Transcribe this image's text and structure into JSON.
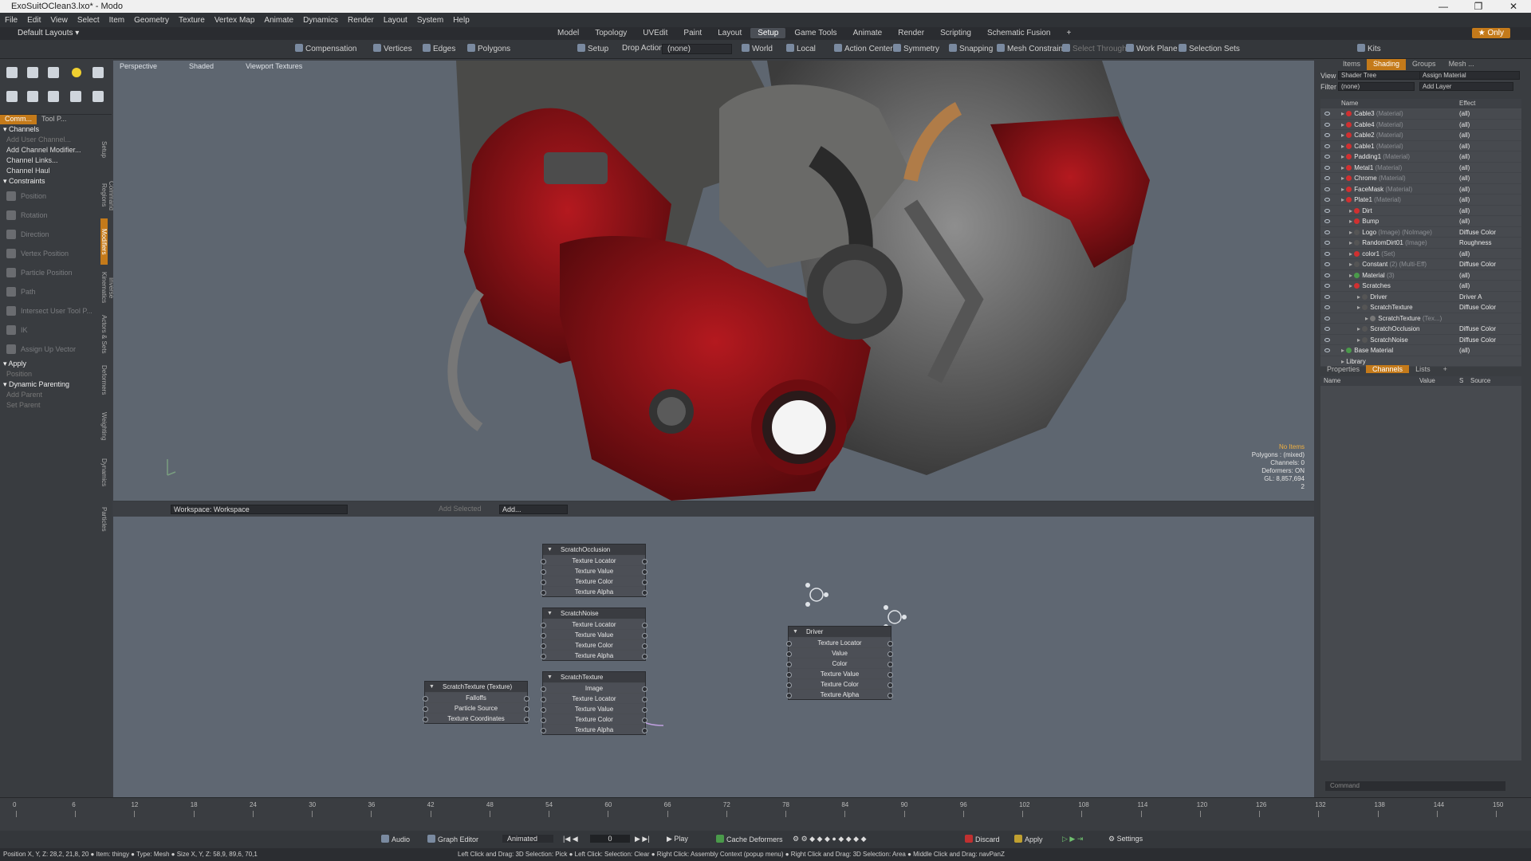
{
  "window": {
    "title": "ExoSuitOClean3.lxo* - Modo",
    "controls": [
      "—",
      "❐",
      "✕"
    ]
  },
  "menu": [
    "File",
    "Edit",
    "View",
    "Select",
    "Item",
    "Geometry",
    "Texture",
    "Vertex Map",
    "Animate",
    "Dynamics",
    "Render",
    "Layout",
    "System",
    "Help"
  ],
  "layout_selector": "Default Layouts",
  "tabs": [
    "Model",
    "Topology",
    "UVEdit",
    "Paint",
    "Layout",
    "Setup",
    "Game Tools",
    "Animate",
    "Render",
    "Scripting",
    "Schematic Fusion",
    "+"
  ],
  "active_tab": "Setup",
  "only_button": "Only",
  "toolbar": {
    "compensation": "Compensation",
    "vertices": "Vertices",
    "edges": "Edges",
    "polygons": "Polygons",
    "setup": "Setup",
    "drop_action_label": "Drop Action",
    "drop_action_value": "(none)",
    "world": "World",
    "local": "Local",
    "action_center": "Action Center",
    "symmetry": "Symmetry",
    "snapping": "Snapping",
    "mesh_constraint": "Mesh Constraint",
    "select_through": "Select Through",
    "work_plane": "Work Plane",
    "selection_sets": "Selection Sets",
    "kits": "Kits"
  },
  "left_panel": {
    "tabs": [
      "Comm...",
      "Tool P..."
    ],
    "vertical_tabs": [
      "Setup",
      "Command Regions",
      "Modifiers",
      "Inverse Kinematics",
      "Actors & Sets",
      "Deformers",
      "Weighting",
      "Dynamics",
      "Particles"
    ],
    "channels_header": "Channels",
    "channel_items": [
      {
        "label": "Add User Channel...",
        "dim": true
      },
      {
        "label": "Add Channel Modifier...",
        "dim": false
      },
      {
        "label": "Channel Links...",
        "dim": false
      },
      {
        "label": "Channel Haul",
        "dim": false
      }
    ],
    "constraints_header": "Constraints",
    "constraint_items": [
      "Position",
      "Rotation",
      "Direction",
      "Vertex Position",
      "Particle Position",
      "Path",
      "Intersect User Tool P...",
      "IK",
      "Assign Up Vector"
    ],
    "apply_header": "Apply",
    "apply_items": [
      "Position"
    ],
    "dynamic_parenting_header": "Dynamic Parenting",
    "dynamic_items": [
      "Add Parent"
    ],
    "set_parent_label": "Set Parent"
  },
  "viewport": {
    "labels": [
      "Perspective",
      "Shaded",
      "Viewport Textures"
    ],
    "info": [
      "No Items",
      "Polygons : (mixed)",
      "Channels: 0",
      "Deformers: ON",
      "GL: 8,857,694",
      "2"
    ]
  },
  "schematic": {
    "workspace": "Workspace: Workspace",
    "add_selected": "Add Selected",
    "add": "Add...",
    "nodes": [
      {
        "title": "ScratchOcclusion",
        "rows": [
          "Texture Locator",
          "Texture Value",
          "Texture Color",
          "Texture Alpha"
        ]
      },
      {
        "title": "ScratchNoise",
        "rows": [
          "Texture Locator",
          "Texture Value",
          "Texture Color",
          "Texture Alpha"
        ]
      },
      {
        "title": "ScratchTexture",
        "rows": [
          "Image",
          "Texture Locator",
          "Texture Value",
          "Texture Color",
          "Texture Alpha"
        ]
      },
      {
        "title": "ScratchTexture (Texture)",
        "rows": [
          "Falloffs",
          "Particle Source",
          "Texture Coordinates"
        ]
      },
      {
        "title": "Driver",
        "rows": [
          "Texture Locator",
          "Value",
          "Color",
          "Texture Value",
          "Texture Color",
          "Texture Alpha"
        ]
      }
    ]
  },
  "right_panel": {
    "tabs": [
      "Items",
      "Shading",
      "Groups",
      "Mesh ..."
    ],
    "active_tab": "Shading",
    "view_label": "View",
    "view_value": "Shader Tree",
    "assign_material": "Assign Material",
    "filter_label": "Filter",
    "filter_value": "(none)",
    "add_layer": "Add Layer",
    "col_name": "Name",
    "col_effect": "Effect",
    "rows": [
      {
        "indent": 0,
        "name": "Cable3",
        "sub": "(Material)",
        "effect": "(all)",
        "color": "#d03030"
      },
      {
        "indent": 0,
        "name": "Cable4",
        "sub": "(Material)",
        "effect": "(all)",
        "color": "#d03030"
      },
      {
        "indent": 0,
        "name": "Cable2",
        "sub": "(Material)",
        "effect": "(all)",
        "color": "#d03030"
      },
      {
        "indent": 0,
        "name": "Cable1",
        "sub": "(Material)",
        "effect": "(all)",
        "color": "#d03030"
      },
      {
        "indent": 0,
        "name": "Padding1",
        "sub": "(Material)",
        "effect": "(all)",
        "color": "#d03030"
      },
      {
        "indent": 0,
        "name": "Metal1",
        "sub": "(Material)",
        "effect": "(all)",
        "color": "#d03030"
      },
      {
        "indent": 0,
        "name": "Chrome",
        "sub": "(Material)",
        "effect": "(all)",
        "color": "#d03030"
      },
      {
        "indent": 0,
        "name": "FaceMask",
        "sub": "(Material)",
        "effect": "(all)",
        "color": "#d03030"
      },
      {
        "indent": 0,
        "name": "Plate1",
        "sub": "(Material)",
        "effect": "(all)",
        "color": "#d03030"
      },
      {
        "indent": 1,
        "name": "Dirt",
        "sub": "",
        "effect": "(all)",
        "color": "#d03030"
      },
      {
        "indent": 1,
        "name": "Bump",
        "sub": "",
        "effect": "(all)",
        "color": "#d03030"
      },
      {
        "indent": 1,
        "name": "Logo",
        "sub": "(Image) (NoImage)",
        "effect": "Diffuse Color",
        "color": "#555"
      },
      {
        "indent": 1,
        "name": "RandomDirt01",
        "sub": "(Image)",
        "effect": "Roughness",
        "color": "#555"
      },
      {
        "indent": 1,
        "name": "color1",
        "sub": "(Set)",
        "effect": "(all)",
        "color": "#d03030"
      },
      {
        "indent": 1,
        "name": "Constant",
        "sub": "(2) (Multi-Eff)",
        "effect": "Diffuse Color",
        "color": "#555"
      },
      {
        "indent": 1,
        "name": "Material",
        "sub": "(3)",
        "effect": "(all)",
        "color": "#4a9a4a"
      },
      {
        "indent": 1,
        "name": "Scratches",
        "sub": "",
        "effect": "(all)",
        "color": "#d03030"
      },
      {
        "indent": 2,
        "name": "Driver",
        "sub": "",
        "effect": "Driver A",
        "color": "#555"
      },
      {
        "indent": 2,
        "name": "ScratchTexture",
        "sub": "",
        "effect": "Diffuse Color",
        "color": "#555"
      },
      {
        "indent": 3,
        "name": "ScratchTexture",
        "sub": "(Tex...)",
        "effect": "",
        "color": "#777"
      },
      {
        "indent": 2,
        "name": "ScratchOcclusion",
        "sub": "",
        "effect": "Diffuse Color",
        "color": "#555"
      },
      {
        "indent": 2,
        "name": "ScratchNoise",
        "sub": "",
        "effect": "Diffuse Color",
        "color": "#555"
      },
      {
        "indent": 0,
        "name": "Base Material",
        "sub": "",
        "effect": "(all)",
        "color": "#4a9a4a"
      },
      {
        "indent": 0,
        "name": "Library",
        "sub": "",
        "effect": "",
        "color": ""
      }
    ],
    "lower_tabs": [
      "Properties",
      "Channels",
      "Lists",
      "+"
    ],
    "lower_active": "Channels",
    "channel_cols": [
      "Name",
      "Value",
      "S",
      "Source"
    ],
    "command_placeholder": "Command"
  },
  "timeline": {
    "ticks": [
      "0",
      "6",
      "12",
      "18",
      "24",
      "30",
      "36",
      "42",
      "48",
      "54",
      "60",
      "66",
      "72",
      "78",
      "84",
      "90",
      "96",
      "102",
      "108",
      "114",
      "120",
      "126",
      "132",
      "138",
      "144",
      "150"
    ],
    "right_ticks": [
      "120",
      "150"
    ]
  },
  "transport": {
    "audio": "Audio",
    "graph_editor": "Graph Editor",
    "animated": "Animated",
    "frame": "0",
    "play": "Play",
    "cache_deformers": "Cache Deformers",
    "discard": "Discard",
    "apply": "Apply",
    "settings": "Settings"
  },
  "status": {
    "left": "Position X, Y, Z: 28,2, 21,8, 20 ● Item: thingy ● Type: Mesh ● Size X, Y, Z: 58,9, 89,6, 70,1",
    "hints": "Left Click and Drag: 3D Selection: Pick ● Left Click: Selection: Clear ● Right Click: Assembly Context (popup menu) ● Right Click and Drag: 3D Selection: Area ● Middle Click and Drag: navPanZ"
  },
  "colors": {
    "accent": "#c47a1a",
    "suit_red": "#9b1217"
  }
}
